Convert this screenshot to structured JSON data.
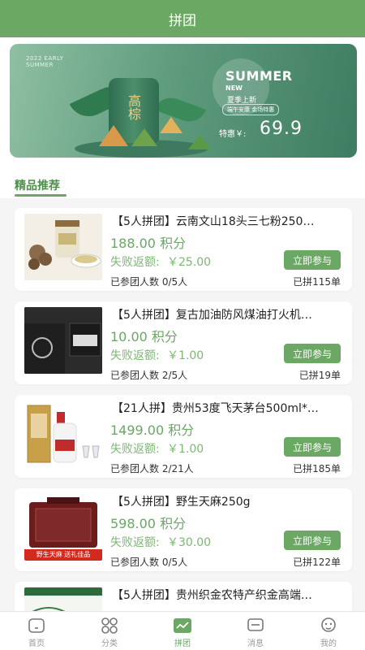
{
  "header": {
    "title": "拼团"
  },
  "banner": {
    "year_text": "2022 EARLY SUMMER",
    "headline": "SUMMER",
    "new_label": "NEW",
    "subtitle": "夏季上新",
    "tagline": "端午安康 金场特惠",
    "price_label": "特惠￥:",
    "price_value": "69.9",
    "can_text": "高棕"
  },
  "section": {
    "title": "精品推荐"
  },
  "products": [
    {
      "title": "【5人拼团】云南文山18头三七粉250…",
      "price": "188.00 积分",
      "refund_label": "失败返额:",
      "refund_value": "￥25.00",
      "joined": "已参团人数 0/5人",
      "sold": "已拼115单",
      "button": "立即参与"
    },
    {
      "title": "【5人拼团】复古加油防风煤油打火机…",
      "price": "10.00 积分",
      "refund_label": "失败返额:",
      "refund_value": "￥1.00",
      "joined": "已参团人数 2/5人",
      "sold": "已拼19单",
      "button": "立即参与"
    },
    {
      "title": "【21人拼】贵州53度飞天茅台500ml*…",
      "price": "1499.00 积分",
      "refund_label": "失败返额:",
      "refund_value": "￥1.00",
      "joined": "已参团人数 2/21人",
      "sold": "已拼185单",
      "button": "立即参与"
    },
    {
      "title": "【5人拼团】野生天麻250g",
      "price": "598.00 积分",
      "refund_label": "失败返额:",
      "refund_value": "￥30.00",
      "joined": "已参团人数 0/5人",
      "sold": "已拼122单",
      "button": "立即参与",
      "thumb_caption": "野生天麻 送礼佳品"
    },
    {
      "title": "【5人拼团】贵州织金农特产织金高端…",
      "price": "",
      "refund_label": "",
      "refund_value": "",
      "joined": "",
      "sold": "",
      "button": ""
    }
  ],
  "tabbar": [
    {
      "label": "首页",
      "icon": "home-icon"
    },
    {
      "label": "分类",
      "icon": "category-icon"
    },
    {
      "label": "拼团",
      "icon": "group-buy-icon",
      "active": true
    },
    {
      "label": "消息",
      "icon": "message-icon"
    },
    {
      "label": "我的",
      "icon": "profile-icon"
    }
  ],
  "colors": {
    "brand": "#6aa864",
    "refund_text": "#7db873",
    "background": "#f5f5f5"
  }
}
